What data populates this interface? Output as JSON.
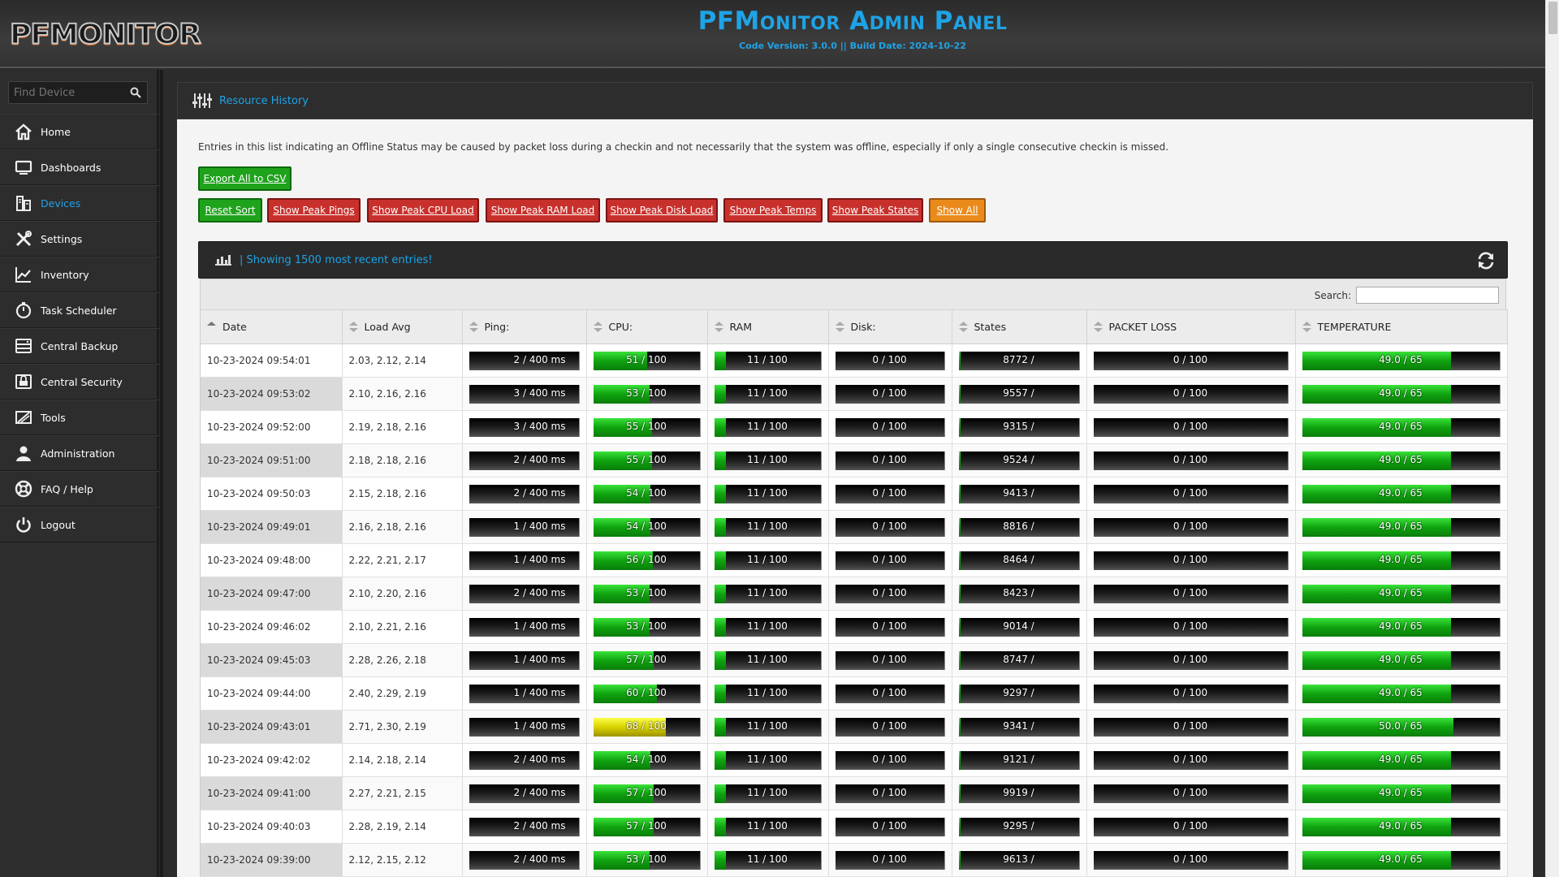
{
  "header": {
    "logo": "PFMONITOR",
    "title": "PFMonitor Admin Panel",
    "subtitle": "Code Version: 3.0.0 || Build Date: 2024-10-22"
  },
  "sidebar": {
    "search_placeholder": "Find Device",
    "items": [
      {
        "label": "Home",
        "icon": "home-icon"
      },
      {
        "label": "Dashboards",
        "icon": "monitor-icon"
      },
      {
        "label": "Devices",
        "icon": "server-icon",
        "active": true
      },
      {
        "label": "Settings",
        "icon": "tools-icon"
      },
      {
        "label": "Inventory",
        "icon": "chart-line-icon"
      },
      {
        "label": "Task Scheduler",
        "icon": "stopwatch-icon"
      },
      {
        "label": "Central Backup",
        "icon": "backup-icon"
      },
      {
        "label": "Central Security",
        "icon": "security-icon"
      },
      {
        "label": "Tools",
        "icon": "wrench-icon"
      },
      {
        "label": "Administration",
        "icon": "user-icon"
      },
      {
        "label": "FAQ / Help",
        "icon": "lifebuoy-icon"
      },
      {
        "label": "Logout",
        "icon": "power-icon"
      }
    ]
  },
  "panel": {
    "title": "Resource History",
    "note": "Entries in this list indicating an Offline Status may be caused by packet loss during a checkin and not necessarily that the system was offline, especially if only a single consecutive checkin is missed.",
    "export_label": "Export All to CSV",
    "buttons": {
      "reset": "Reset Sort",
      "pings": "Show Peak Pings",
      "cpu": "Show Peak CPU Load",
      "ram": "Show Peak RAM Load",
      "disk": "Show Peak Disk Load",
      "temps": "Show Peak Temps",
      "states": "Show Peak States",
      "all": "Show All"
    }
  },
  "table": {
    "info": "| Showing 1500 most recent entries!",
    "search_label": "Search:",
    "columns": [
      "Date",
      "Load Avg",
      "Ping:",
      "CPU:",
      "RAM",
      "Disk:",
      "States",
      "PACKET LOSS",
      "TEMPERATURE"
    ],
    "rows": [
      {
        "date": "10-23-2024 09:54:01",
        "load": "2.03, 2.12, 2.14",
        "ping": "2 / 400 ms",
        "cpu": 51,
        "ram": 11,
        "disk": 0,
        "states": "8772 /",
        "loss": 0,
        "temp": "49.0"
      },
      {
        "date": "10-23-2024 09:53:02",
        "load": "2.10, 2.16, 2.16",
        "ping": "3 / 400 ms",
        "cpu": 53,
        "ram": 11,
        "disk": 0,
        "states": "9557 /",
        "loss": 0,
        "temp": "49.0"
      },
      {
        "date": "10-23-2024 09:52:00",
        "load": "2.19, 2.18, 2.16",
        "ping": "3 / 400 ms",
        "cpu": 55,
        "ram": 11,
        "disk": 0,
        "states": "9315 /",
        "loss": 0,
        "temp": "49.0"
      },
      {
        "date": "10-23-2024 09:51:00",
        "load": "2.18, 2.18, 2.16",
        "ping": "2 / 400 ms",
        "cpu": 55,
        "ram": 11,
        "disk": 0,
        "states": "9524 /",
        "loss": 0,
        "temp": "49.0"
      },
      {
        "date": "10-23-2024 09:50:03",
        "load": "2.15, 2.18, 2.16",
        "ping": "2 / 400 ms",
        "cpu": 54,
        "ram": 11,
        "disk": 0,
        "states": "9413 /",
        "loss": 0,
        "temp": "49.0"
      },
      {
        "date": "10-23-2024 09:49:01",
        "load": "2.16, 2.18, 2.16",
        "ping": "1 / 400 ms",
        "cpu": 54,
        "ram": 11,
        "disk": 0,
        "states": "8816 /",
        "loss": 0,
        "temp": "49.0"
      },
      {
        "date": "10-23-2024 09:48:00",
        "load": "2.22, 2.21, 2.17",
        "ping": "1 / 400 ms",
        "cpu": 56,
        "ram": 11,
        "disk": 0,
        "states": "8464 /",
        "loss": 0,
        "temp": "49.0"
      },
      {
        "date": "10-23-2024 09:47:00",
        "load": "2.10, 2.20, 2.16",
        "ping": "2 / 400 ms",
        "cpu": 53,
        "ram": 11,
        "disk": 0,
        "states": "8423 /",
        "loss": 0,
        "temp": "49.0"
      },
      {
        "date": "10-23-2024 09:46:02",
        "load": "2.10, 2.21, 2.16",
        "ping": "1 / 400 ms",
        "cpu": 53,
        "ram": 11,
        "disk": 0,
        "states": "9014 /",
        "loss": 0,
        "temp": "49.0"
      },
      {
        "date": "10-23-2024 09:45:03",
        "load": "2.28, 2.26, 2.18",
        "ping": "1 / 400 ms",
        "cpu": 57,
        "ram": 11,
        "disk": 0,
        "states": "8747 /",
        "loss": 0,
        "temp": "49.0"
      },
      {
        "date": "10-23-2024 09:44:00",
        "load": "2.40, 2.29, 2.19",
        "ping": "1 / 400 ms",
        "cpu": 60,
        "ram": 11,
        "disk": 0,
        "states": "9297 /",
        "loss": 0,
        "temp": "49.0"
      },
      {
        "date": "10-23-2024 09:43:01",
        "load": "2.71, 2.30, 2.19",
        "ping": "1 / 400 ms",
        "cpu": 68,
        "ram": 11,
        "disk": 0,
        "states": "9341 /",
        "loss": 0,
        "temp": "50.0"
      },
      {
        "date": "10-23-2024 09:42:02",
        "load": "2.14, 2.18, 2.14",
        "ping": "2 / 400 ms",
        "cpu": 54,
        "ram": 11,
        "disk": 0,
        "states": "9121 /",
        "loss": 0,
        "temp": "49.0"
      },
      {
        "date": "10-23-2024 09:41:00",
        "load": "2.27, 2.21, 2.15",
        "ping": "2 / 400 ms",
        "cpu": 57,
        "ram": 11,
        "disk": 0,
        "states": "9919 /",
        "loss": 0,
        "temp": "49.0"
      },
      {
        "date": "10-23-2024 09:40:03",
        "load": "2.28, 2.19, 2.14",
        "ping": "2 / 400 ms",
        "cpu": 57,
        "ram": 11,
        "disk": 0,
        "states": "9295 /",
        "loss": 0,
        "temp": "49.0"
      },
      {
        "date": "10-23-2024 09:39:00",
        "load": "2.12, 2.15, 2.12",
        "ping": "2 / 400 ms",
        "cpu": 53,
        "ram": 11,
        "disk": 0,
        "states": "9613 /",
        "loss": 0,
        "temp": "49.0"
      }
    ],
    "cpu_max": "100",
    "ram_max": "100",
    "disk_max": "100",
    "loss_max": "100",
    "temp_max": "65",
    "colors": {
      "ok": "#0fa30f",
      "warn": "#d9d200",
      "accent": "#1ea3e6"
    }
  }
}
